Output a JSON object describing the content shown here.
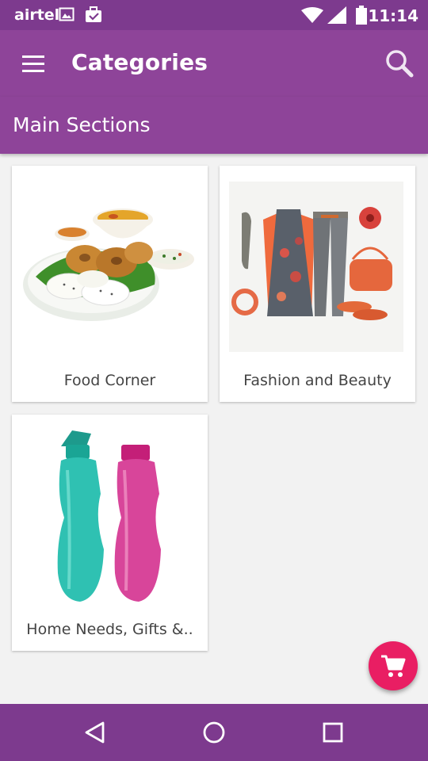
{
  "status_bar": {
    "carrier": "airtel",
    "time": "11:14",
    "icons": [
      "image-icon",
      "briefcase-notification-icon",
      "wifi-icon",
      "signal-icon",
      "battery-icon"
    ]
  },
  "app_bar": {
    "title": "Categories",
    "menu_icon": "hamburger-menu-icon",
    "search_icon": "search-icon"
  },
  "section": {
    "title": "Main Sections"
  },
  "categories": [
    {
      "label": "Food Corner",
      "image": "south-indian-food-plate-image"
    },
    {
      "label": "Fashion and Beauty",
      "image": "fashion-outfit-collage-image"
    },
    {
      "label": "Home Needs, Gifts &..",
      "image": "water-bottles-image"
    }
  ],
  "fab": {
    "icon": "shopping-cart-icon"
  },
  "nav_bar": {
    "icons": [
      "back-triangle-icon",
      "home-circle-icon",
      "recents-square-icon"
    ]
  },
  "colors": {
    "primary": "#8e4499",
    "primary_dark": "#7d3a8e",
    "accent": "#e91e63",
    "background": "#f2f2f2"
  }
}
